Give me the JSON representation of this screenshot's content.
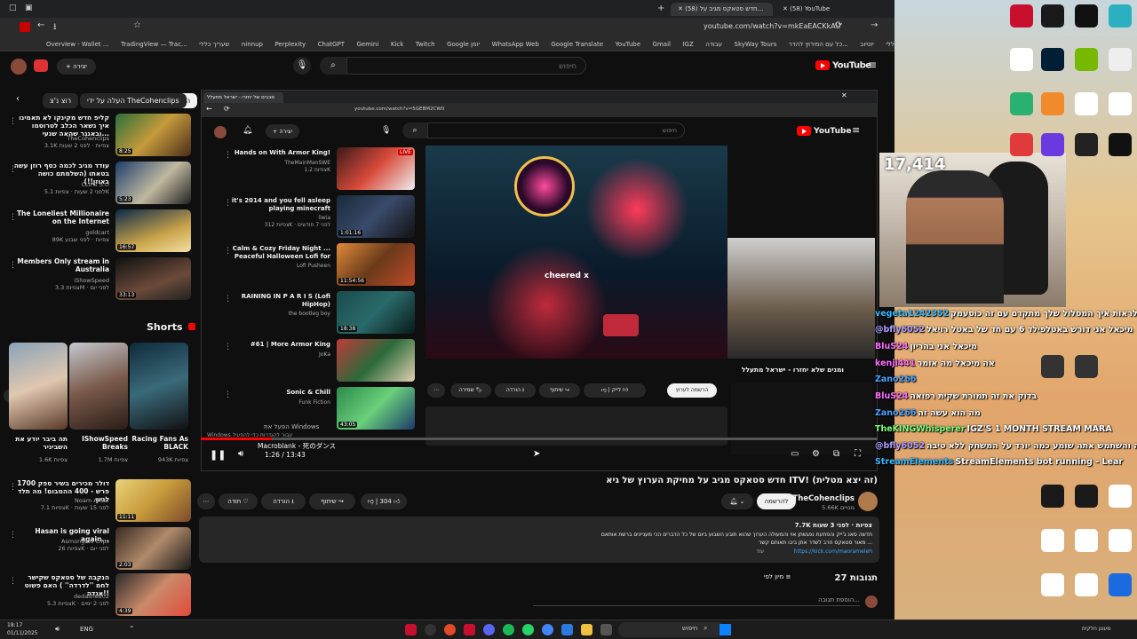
{
  "browser": {
    "tabs": [
      {
        "label": "(58) YouTube"
      },
      {
        "label": "(58) חדש סטאקס מגיב על..."
      }
    ],
    "url": "youtube.com/watch?v=mkEaEACKkAU",
    "bookmarks": [
      "Overview - Wallet ...",
      "TradingView — Trac...",
      "שעריך כללי",
      "ninnup",
      "Perplexity",
      "ChatGPT",
      "Gemini",
      "Kick",
      "Twitch",
      "Google יומן",
      "WhatsApp Web",
      "Google Translate",
      "YouTube",
      "Gmail",
      "IGZ",
      "עבודה",
      "SkyWay Tours",
      "כל עם המירוץ להדר...",
      "יוטיוב",
      "כללי"
    ]
  },
  "youtube": {
    "brand": "YouTube",
    "search_placeholder": "חיפוש",
    "create_label": "יצירה",
    "chips": [
      "הכול",
      "העלה על ידי TheCohenclips",
      "רוצ נ'צ"
    ],
    "sidebar_videos": [
      {
        "title": "קליפ חדש מקינקו לא תאמינו איך נשאר הכלב לטרוסמו ובאנגר שהאה שנעי...",
        "channel": "TheCohenclips",
        "meta": "3.1K צפיות · לפני 2 שעות",
        "duration": "8:25"
      },
      {
        "title": "עודד מגיב לכמה כסף רוזן עשה בטאתו (השלמתם כושה באוזן!!)",
        "channel": "CLIPS S.O",
        "meta": "לפני 2 שעות · צפיות 5.1K",
        "duration": "5:23"
      },
      {
        "title": "The Loneliest Millionaire on the Internet",
        "channel": "goldcart",
        "meta": "89K צפיות · לפני שבוע",
        "duration": "16:57"
      },
      {
        "title": "Members Only stream in Australia",
        "channel": "iShowSpeed",
        "meta": "צפיות 3.3M · לפני יום",
        "duration": "33:13"
      }
    ],
    "shorts_heading": "Shorts",
    "shorts": [
      {
        "title": "תה ביבר יודע את השביניר",
        "views": "1.6K צפיות"
      },
      {
        "title": "IShowSpeed Breaks",
        "views": "1.7M צפיות"
      },
      {
        "title": "Racing Fans As BLACK",
        "views": "943K צפיות"
      }
    ],
    "sidebar_videos_2": [
      {
        "title": "1700 דולר מכירים בשיר ספק פרש - 400 ההמבום! מה תלד לניון",
        "channel": "Noam Antar",
        "meta": "צפיות 7.1K · לפני 15 שעות",
        "duration": "11:11"
      },
      {
        "title": "Hasan is going viral again...",
        "channel": "Asmongold Clips",
        "meta": "צפיות 26K · לפני יום",
        "duration": "2:03"
      },
      {
        "title": "הנקבה של סטאקס שקישר לחמ ''לדרדה'' ) האם פשוט אגדה!!",
        "channel": "dedashee02",
        "meta": "צפיות 5.3K · לפני 2 ימים",
        "duration": "4:39"
      }
    ],
    "video_title": "חדש סטאקס מגיב על מחיקת הערוץ של גיא ITV! (זה יצא מטלית)",
    "channel_name": "TheCohenclips",
    "subscribers": "5.66K מנויים",
    "subscribe_label": "להרשמה",
    "like_count": "304",
    "share_label": "שיתוף",
    "download_label": "הורדה",
    "thanks_label": "תודה",
    "desc_stats": "7.7K צפיות · לפני 3 שעות",
    "desc_line1": "חדשה סאנ ג'ייק והפתעת נפגשתן אוי והמעולה הערוך שהוא תובע השבוע ביום של כל הדברים הכי מעניינים ברשת אותאם",
    "desc_line2": "מאור סטאקס חרב לשדר אתן ביבו תאותם קשר ...",
    "desc_link": "https://kick.com/maorameleh",
    "desc_more": "עוד",
    "comments_count": "27 תגובות",
    "sort_label": "מיון לפי",
    "add_comment": "הוספת תגובה...",
    "player_time": "1:26 / 13:43",
    "player_overlay": "Macroblank - 死のダンス"
  },
  "inner": {
    "url": "youtube.com/watch?v=5GEBM2CW0",
    "tab_label": "סבבים של יחזרו - ישראל מתעלל",
    "search_placeholder": "חיפוש",
    "create_label": "יצירה",
    "cheered": "cheered x",
    "live_tag": "LIVE",
    "subscribe": "הרשמה לערוץ",
    "like": "לייק",
    "share": "שיתוף",
    "download": "הורדה",
    "save": "שמירה",
    "stream_title": "ומנים שלא יחזרו - ישראל מתעלל",
    "windows_watermark_1": "הפעל את Windows",
    "windows_watermark_2": "Windows עבור להגדרות כדי להפעיל",
    "rec": [
      {
        "title": "Hands on With Armor King!",
        "channel": "TheMainManSWE",
        "meta": "צפיות 1.2K",
        "badge": "LIVE"
      },
      {
        "title": "it's 2014 and you fell asleep playing minecraft",
        "channel": "liwia",
        "meta": "צפיות 312K · לפני 7 חודשים",
        "duration": "1:01:16"
      },
      {
        "title": "Calm & Cozy Friday Night ... Peaceful Halloween Lofi for",
        "channel": "Lofi Pusheen",
        "meta": "",
        "duration": "11:54:56"
      },
      {
        "title": "RAINING IN P A R I S (Lofi HipHop)",
        "channel": "the bootleg boy",
        "meta": "",
        "duration": "18:38"
      },
      {
        "title": "#61 | More Armor King",
        "channel": "JoKa",
        "meta": "",
        "duration": ""
      },
      {
        "title": "Sonic & Chill",
        "channel": "Funk Fiction",
        "meta": "",
        "duration": "43:05"
      }
    ]
  },
  "stream": {
    "viewer_count": "17,414",
    "chat": [
      {
        "user": "vegeta1242352",
        "msg": "לראות איך המסלול שלך מתקדם עם זה כוסעמק",
        "color": "#3cb9ff"
      },
      {
        "user": "@bfly6052",
        "msg": "מיכאל אני דורש באטלפילד 6 עם חד של באטל רויאל",
        "color": "#b0a0ff"
      },
      {
        "user": "BluS24",
        "msg": "מיכאל אני בהריון",
        "color": "#ff6dff"
      },
      {
        "user": "kenji441",
        "msg": "אה מיכאל מה אומר",
        "color": "#ff6dff"
      },
      {
        "user": "Zano266",
        "msg": "",
        "color": "#4aa3ff"
      },
      {
        "user": "BluS24",
        "msg": "בדוק את זה תמורת שקית רפואה",
        "color": "#ff6dff"
      },
      {
        "user": "Zano266",
        "msg": "מה הוא עשה זה",
        "color": "#4aa3ff"
      },
      {
        "user": "TheKINGWhisperer",
        "msg": "IGZ'S 1 MONTH STREAM MARA",
        "color": "#7dff7d"
      },
      {
        "user": "@bfly6052",
        "msg": "קנה והשתמש אתה שומע כמה יורד על המשחק ללא טיבה",
        "color": "#b0a0ff"
      },
      {
        "user": "StreamElements",
        "msg": "StreamElements bot running - Lear",
        "color": "#3cb9ff"
      }
    ],
    "desktop_icons": [
      "Steam",
      "Fortnite",
      "Discord",
      "Photoshop",
      "NVIDIA",
      "OBS Studio",
      "Chrome",
      "Meta Quest",
      "Roblox"
    ]
  },
  "taskbar": {
    "search": "חיפוש",
    "time": "18:17",
    "date": "01/11/2025",
    "lang": "ENG",
    "weather": "מעונן חלקית"
  },
  "colors": {
    "youtube_red": "#ff0000",
    "bg": "#0f0f0f",
    "chip_bg": "#272727"
  }
}
